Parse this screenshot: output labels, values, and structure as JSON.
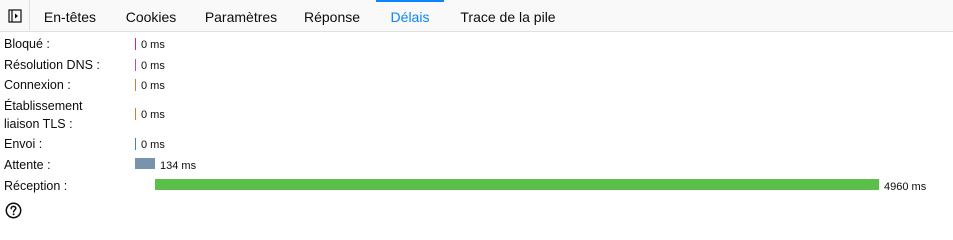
{
  "tabs": [
    {
      "label": "En-têtes",
      "selected": false
    },
    {
      "label": "Cookies",
      "selected": false
    },
    {
      "label": "Paramètres",
      "selected": false
    },
    {
      "label": "Réponse",
      "selected": false
    },
    {
      "label": "Délais",
      "selected": true
    },
    {
      "label": "Trace de la pile",
      "selected": false
    }
  ],
  "toggle_icon": "sidebar-toggle-icon",
  "timings": [
    {
      "label": "Bloqué :",
      "value": "0 ms",
      "ms": 0,
      "color": "#e22850"
    },
    {
      "label": "Résolution DNS :",
      "value": "0 ms",
      "ms": 0,
      "color": "#b04eb5"
    },
    {
      "label": "Connexion :",
      "value": "0 ms",
      "ms": 0,
      "color": "#d7782b"
    },
    {
      "label": "Établissement liaison TLS :",
      "value": "0 ms",
      "ms": 0,
      "color": "#d7782b"
    },
    {
      "label": "Envoi :",
      "value": "0 ms",
      "ms": 0,
      "color": "#2b8fa6"
    },
    {
      "label": "Attente :",
      "value": "134 ms",
      "ms": 134,
      "color": "#7893ae"
    },
    {
      "label": "Réception :",
      "value": "4960 ms",
      "ms": 4960,
      "color": "#5bc04a"
    }
  ],
  "help_icon": "help-icon"
}
